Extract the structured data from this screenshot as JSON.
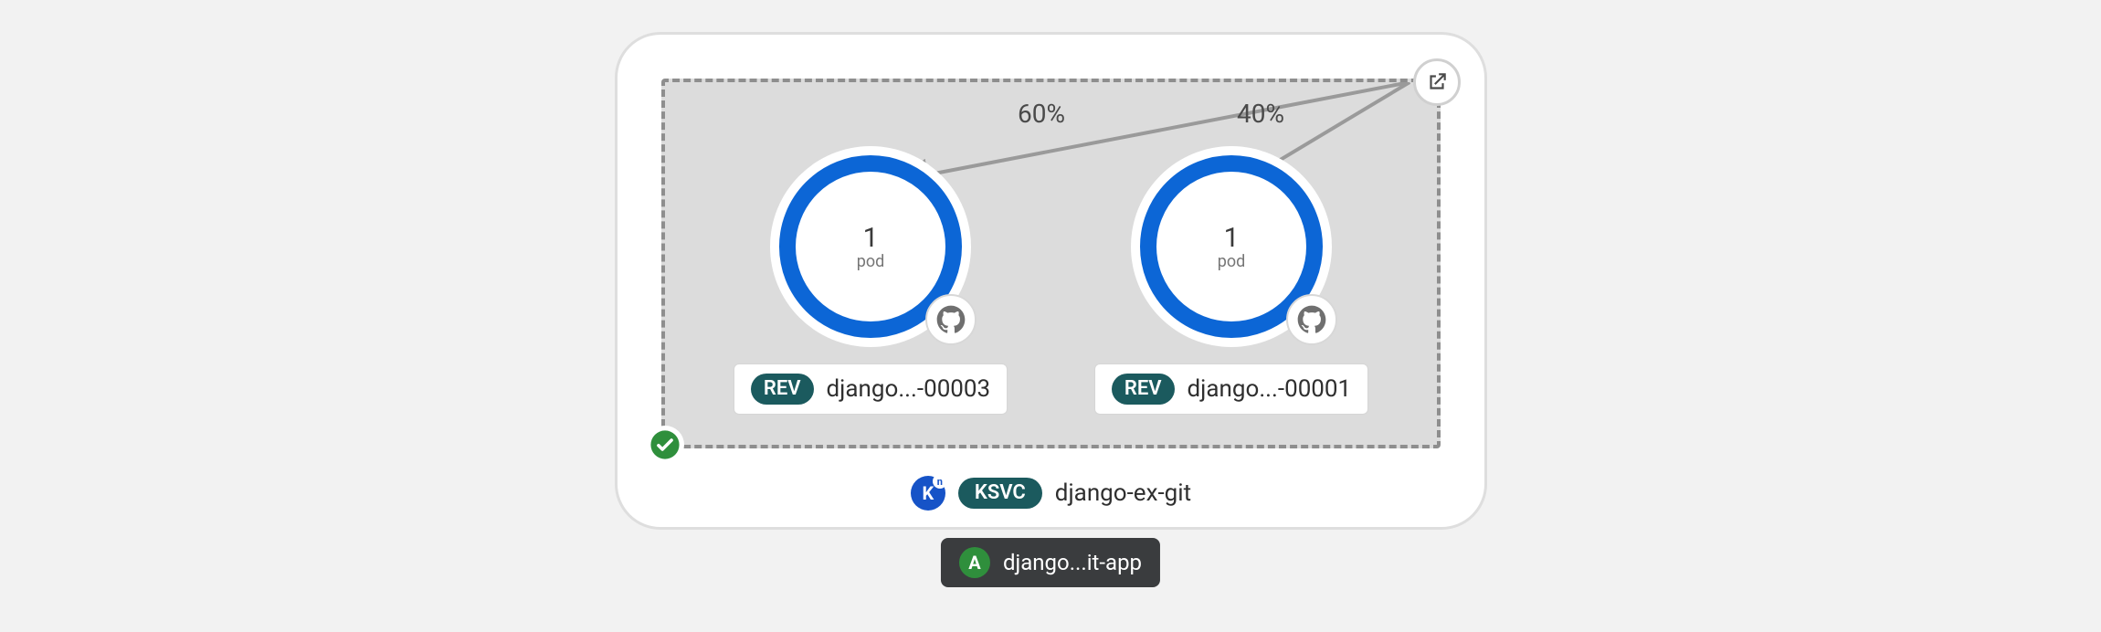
{
  "service": {
    "kind_short": "KSVC",
    "name": "django-ex-git",
    "knative_letter": "K",
    "route_open_icon": "external-link-icon",
    "build_status": "success"
  },
  "traffic": [
    {
      "percent": "60%",
      "target_revision_index": 0
    },
    {
      "percent": "40%",
      "target_revision_index": 1
    }
  ],
  "revisions": [
    {
      "kind_short": "REV",
      "name": "django...-00003",
      "pod_count": "1",
      "pod_unit": "pod",
      "source_icon": "github-icon"
    },
    {
      "kind_short": "REV",
      "name": "django...-00001",
      "pod_count": "1",
      "pod_unit": "pod",
      "source_icon": "github-icon"
    }
  ],
  "app": {
    "initial": "A",
    "name": "django...it-app"
  },
  "colors": {
    "ring_blue": "#0c66d6",
    "pill_teal": "#1b5a5e",
    "knative_blue": "#1653c7",
    "app_green": "#2f8f3c",
    "chip_bg": "#3a3c3e"
  }
}
